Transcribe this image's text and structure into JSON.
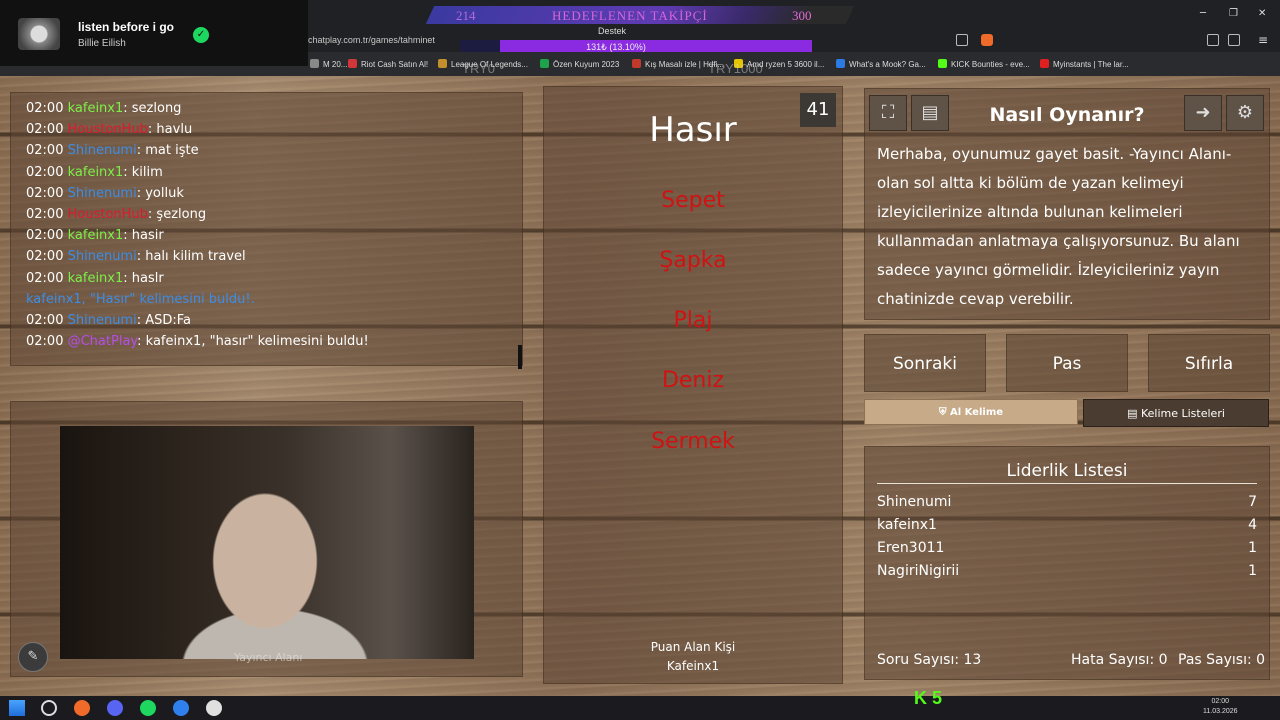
{
  "now_playing": {
    "title": "listen before i go",
    "artist": "Billie Eilish"
  },
  "browser": {
    "url": "chatplay.com.tr/games/tahminet",
    "bookmarks": [
      {
        "label": "M 20...",
        "color": "#888"
      },
      {
        "label": "Riot Cash Satın Al!",
        "color": "#d13639"
      },
      {
        "label": "League Of Legends...",
        "color": "#c28f2c"
      },
      {
        "label": "Özen Kuyum 2023",
        "color": "#1fa34a"
      },
      {
        "label": "Kış Masalı izle | Hdfi...",
        "color": "#c0392b"
      },
      {
        "label": "Amd ryzen 5 3600 il...",
        "color": "#e6c300"
      },
      {
        "label": "What's a Mook? Ga...",
        "color": "#2c7be5"
      },
      {
        "label": "KICK Bounties - eve...",
        "color": "#53fc18"
      },
      {
        "label": "Myinstants | The lar...",
        "color": "#e02020"
      }
    ]
  },
  "overlay": {
    "goal_left": "214",
    "goal_title": "HEDEFLENEN TAKİPÇİ",
    "goal_right": "300",
    "support_label": "Destek",
    "support_progress": "131₺ (13.10%)",
    "support_fraction": 0.131,
    "try_left": "TRY0",
    "try_right": "TRY1000"
  },
  "chat": [
    {
      "time": "02:00",
      "user": "kafeinx1",
      "color": "#7cf048",
      "msg": ": sezlong"
    },
    {
      "time": "02:00",
      "user": "HoustonHub",
      "color": "#e0182e",
      "msg": ": havlu"
    },
    {
      "time": "02:00",
      "user": "Shinenumi",
      "color": "#3b8ee8",
      "msg": ": mat işte"
    },
    {
      "time": "02:00",
      "user": "kafeinx1",
      "color": "#7cf048",
      "msg": ": kilim"
    },
    {
      "time": "02:00",
      "user": "Shinenumi",
      "color": "#3b8ee8",
      "msg": ": yolluk"
    },
    {
      "time": "02:00",
      "user": "HoustonHub",
      "color": "#e0182e",
      "msg": ": şezlong"
    },
    {
      "time": "02:00",
      "user": "kafeinx1",
      "color": "#7cf048",
      "msg": ": hasir"
    },
    {
      "time": "02:00",
      "user": "Shinenumi",
      "color": "#3b8ee8",
      "msg": ": halı kilim travel"
    },
    {
      "time": "02:00",
      "user": "kafeinx1",
      "color": "#7cf048",
      "msg": ": haslr"
    },
    {
      "time": "",
      "user": "",
      "color": "#3b8ee8",
      "msg": "kafeinx1, \"Hasır\" kelimesini buldu!.",
      "system": true
    },
    {
      "time": "02:00",
      "user": "Shinenumi",
      "color": "#3b8ee8",
      "msg": ": ASD:Fa"
    },
    {
      "time": "02:00",
      "user": "@ChatPlay",
      "color": "#b54ee8",
      "msg": ": kafeinx1, \"hasır\" kelimesini buldu!"
    }
  ],
  "webcam": {
    "label": "Yayıncı Alanı"
  },
  "game": {
    "timer": "41",
    "word": "Hasır",
    "forbidden": [
      "Sepet",
      "Şapka",
      "Plaj",
      "Deniz",
      "Sermek"
    ],
    "scorer_label": "Puan Alan Kişi",
    "scorer_name": "Kafeinx1"
  },
  "howto": {
    "title": "Nasıl Oynanır?",
    "text": "Merhaba, oyunumuz gayet basit. -Yayıncı Alanı- olan sol altta ki bölüm de yazan kelimeyi izleyicilerinize altında bulunan kelimeleri kullanmadan anlatmaya çalışıyorsunuz. Bu alanı sadece yayıncı görmelidir. İzleyicileriniz yayın chatinizde cevap verebilir."
  },
  "actions": {
    "next": "Sonraki",
    "pass": "Pas",
    "reset": "Sıfırla",
    "take_word": "Al Kelime",
    "word_lists": "Kelime Listeleri"
  },
  "leaderboard": {
    "title": "Liderlik Listesi",
    "rows": [
      {
        "name": "Shinenumi",
        "score": "7"
      },
      {
        "name": "kafeinx1",
        "score": "4"
      },
      {
        "name": "Eren3011",
        "score": "1"
      },
      {
        "name": "NagiriNigirii",
        "score": "1"
      }
    ],
    "question_count": "Soru Sayısı: 13",
    "error_count": "Hata Sayısı: 0",
    "pass_count": "Pas Sayısı: 0"
  },
  "taskbar": {
    "time": "02:00",
    "date": "11.03.2026",
    "kick_count": "5"
  }
}
